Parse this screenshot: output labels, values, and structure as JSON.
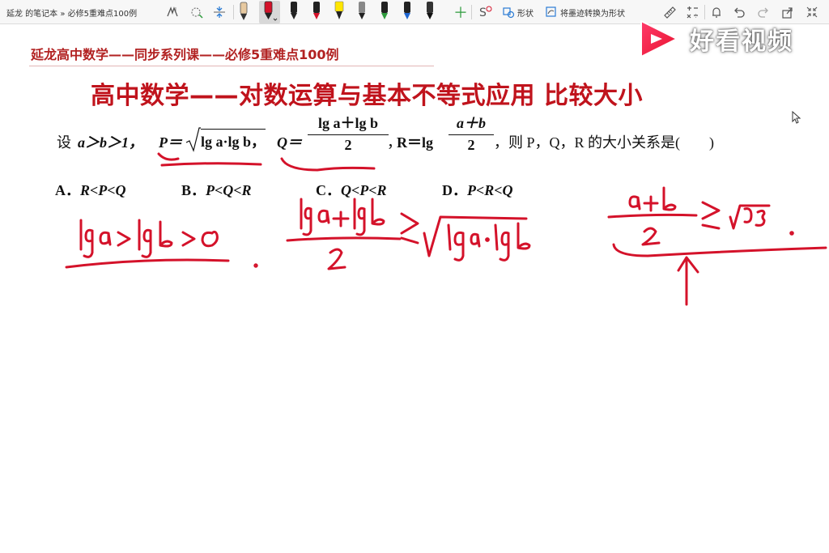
{
  "toolbar": {
    "breadcrumb": "延龙 的笔记本 » 必修5重难点100例",
    "shape_label": "形状",
    "ink_to_shape_label": "将墨迹转换为形状"
  },
  "course": {
    "title": "延龙高中数学——同步系列课——必修5重难点100例"
  },
  "lesson": {
    "title": "高中数学——对数运算与基本不等式应用 比较大小"
  },
  "question": {
    "intro": "设",
    "cond": "a＞b＞1，",
    "p_def": "P＝",
    "p_rad": "lg a·lg b，",
    "q_def": "Q＝",
    "q_num": "lg a＋lg b",
    "q_den": "2",
    "q_sep": "，",
    "r_def": "R＝lg",
    "r_num": "a＋b",
    "r_den": "2",
    "ask": "，则 P，Q，R 的大小关系是(　　)"
  },
  "options": [
    {
      "letter": "A．",
      "text": "R<P<Q"
    },
    {
      "letter": "B．",
      "text": "P<Q<R"
    },
    {
      "letter": "C．",
      "text": "Q<P<R"
    },
    {
      "letter": "D．",
      "text": "P<R<Q"
    }
  ],
  "watermark": {
    "text": "好看视频"
  },
  "colors": {
    "ink": "#d4122a",
    "title_red": "#c0131c",
    "course_red": "#b22222"
  }
}
